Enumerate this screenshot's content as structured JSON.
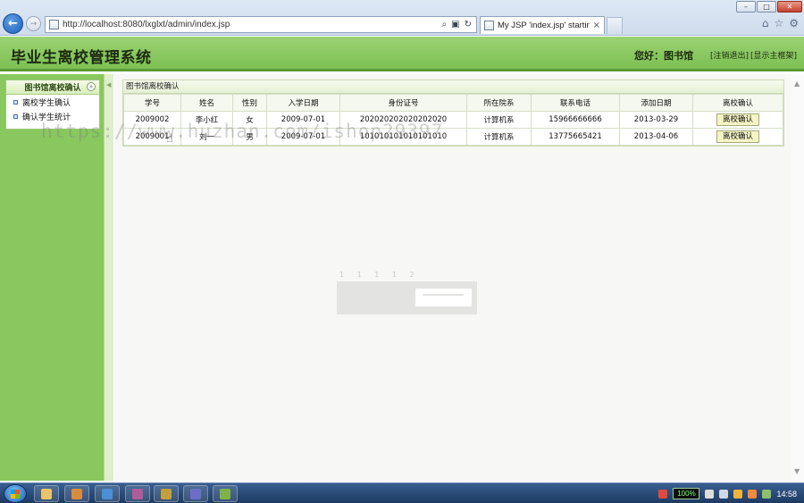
{
  "browser": {
    "url": "http://localhost:8080/lxglxt/admin/index.jsp",
    "tab_title": "My JSP 'index.jsp' startin...",
    "tab_close": "×",
    "win_min": "–",
    "win_max": "□",
    "win_close": "✕"
  },
  "header": {
    "title": "毕业生离校管理系统",
    "greeting": "您好：图书馆",
    "logout_label": "[注销退出]",
    "home_label": "[显示主框架]"
  },
  "sidebar": {
    "panel_title": "图书馆离校确认",
    "items": [
      {
        "label": "离校学生确认"
      },
      {
        "label": "确认学生统计"
      }
    ]
  },
  "main": {
    "panel_title": "图书馆离校确认",
    "columns": [
      "学号",
      "姓名",
      "性别",
      "入学日期",
      "身份证号",
      "所在院系",
      "联系电话",
      "添加日期",
      "离校确认"
    ],
    "rows": [
      {
        "student_id": "2009002",
        "name": "李小红",
        "gender": "女",
        "enroll_date": "2009-07-01",
        "id_card": "202020202020202020",
        "department": "计算机系",
        "phone": "15966666666",
        "added": "2013-03-29",
        "action": "离校确认"
      },
      {
        "student_id": "2009001",
        "name": "刘一",
        "gender": "男",
        "enroll_date": "2009-07-01",
        "id_card": "101010101010101010",
        "department": "计算机系",
        "phone": "13775665421",
        "added": "2013-04-06",
        "action": "离校确认"
      }
    ],
    "loading_dots": "1 1 1 1 2"
  },
  "watermark": "https://www.huzhan.com/ishop29397",
  "taskbar": {
    "battery": "100%",
    "clock": "14:58"
  },
  "colors": {
    "header_green": "#7cc052",
    "sidebar_green": "#88c85e",
    "button_yellow": "#f4f4c4"
  }
}
